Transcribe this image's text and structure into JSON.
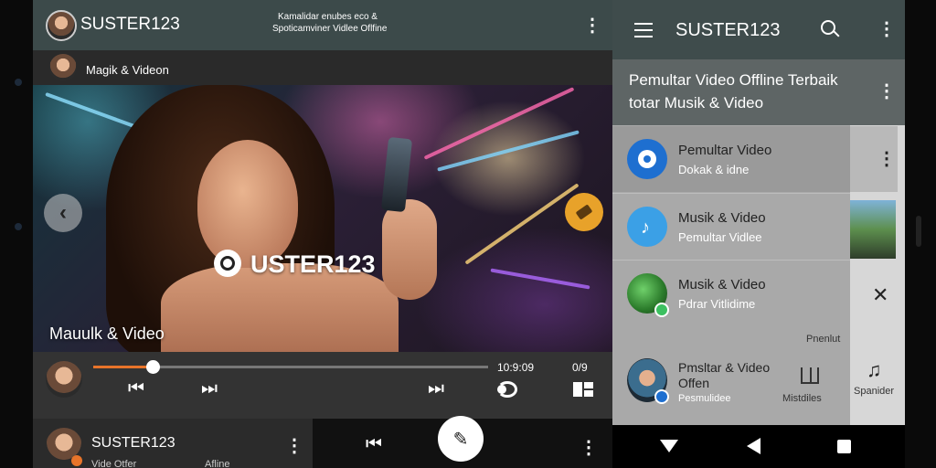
{
  "header": {
    "title": "SUSTER123",
    "caption_line1": "Kamalidar enubes eco &",
    "caption_line2": "Spoticamviner Vidlee Oflfine"
  },
  "channel": {
    "name": "Magik & Videon"
  },
  "video": {
    "watermark": "USTER123",
    "caption": "Mauulk & Video"
  },
  "player": {
    "time": "10:9:09",
    "time_right": "0/9",
    "progress": 0.15
  },
  "mini_player": {
    "title": "SUSTER123",
    "sub_left": "Vide Otfer",
    "sub_right": "Afline"
  },
  "drawer": {
    "app_name": "SUSTER123",
    "heading_line1": "Pemultar Video Offline Terbaik",
    "heading_line2": "totar Musik & Video",
    "items": [
      {
        "title": "Pemultar Video",
        "subtitle": "Dokak & idne"
      },
      {
        "title": "Musik & Video",
        "subtitle": "Pemultar Vidlee"
      },
      {
        "title": "Musik & Video",
        "subtitle": "Pdrar Vitlidime"
      },
      {
        "title": "Pmsltar & Video",
        "title2": "Offen",
        "subtitle": "Pesmulidee"
      }
    ],
    "small_label": "Pnenlut",
    "side_label": "Mistdiles",
    "right_label": "Spanider"
  },
  "colors": {
    "accent": "#e8742a",
    "topbar": "#3c4a4a",
    "drawer_item_blue": "#1e6fd0"
  }
}
